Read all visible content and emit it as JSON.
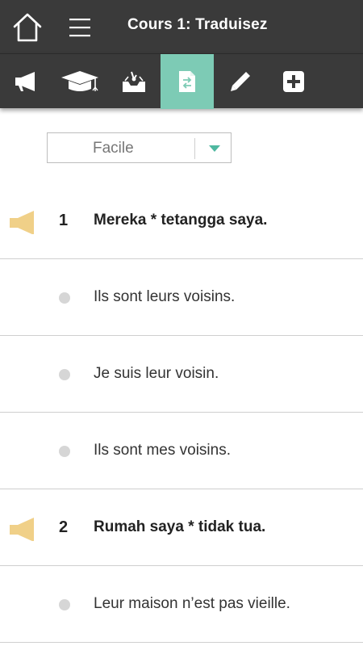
{
  "header": {
    "title": "Cours 1: Traduisez"
  },
  "tabs": [
    {
      "name": "audio",
      "icon": "megaphone-icon",
      "active": false
    },
    {
      "name": "lesson",
      "icon": "graduation-cap-icon",
      "active": false
    },
    {
      "name": "exercise",
      "icon": "inbox-icon",
      "active": false
    },
    {
      "name": "translate",
      "icon": "document-swap-icon",
      "active": true
    },
    {
      "name": "write",
      "icon": "pencil-icon",
      "active": false
    },
    {
      "name": "more",
      "icon": "plus-square-icon",
      "active": false
    }
  ],
  "level_select": {
    "value": "Facile"
  },
  "rows": [
    {
      "type": "question",
      "number": "1",
      "text": "Mereka * tetangga saya."
    },
    {
      "type": "answer",
      "text": "Ils sont leurs voisins."
    },
    {
      "type": "answer",
      "text": "Je suis leur voisin."
    },
    {
      "type": "answer",
      "text": "Ils sont mes voisins."
    },
    {
      "type": "question",
      "number": "2",
      "text": "Rumah saya * tidak tua."
    },
    {
      "type": "answer",
      "text": "Leur maison n’est pas vieille."
    }
  ],
  "colors": {
    "header_bg": "#3a3a3a",
    "accent": "#7dcbb5",
    "speaker": "#f0d088",
    "caret": "#4fb8a0"
  }
}
